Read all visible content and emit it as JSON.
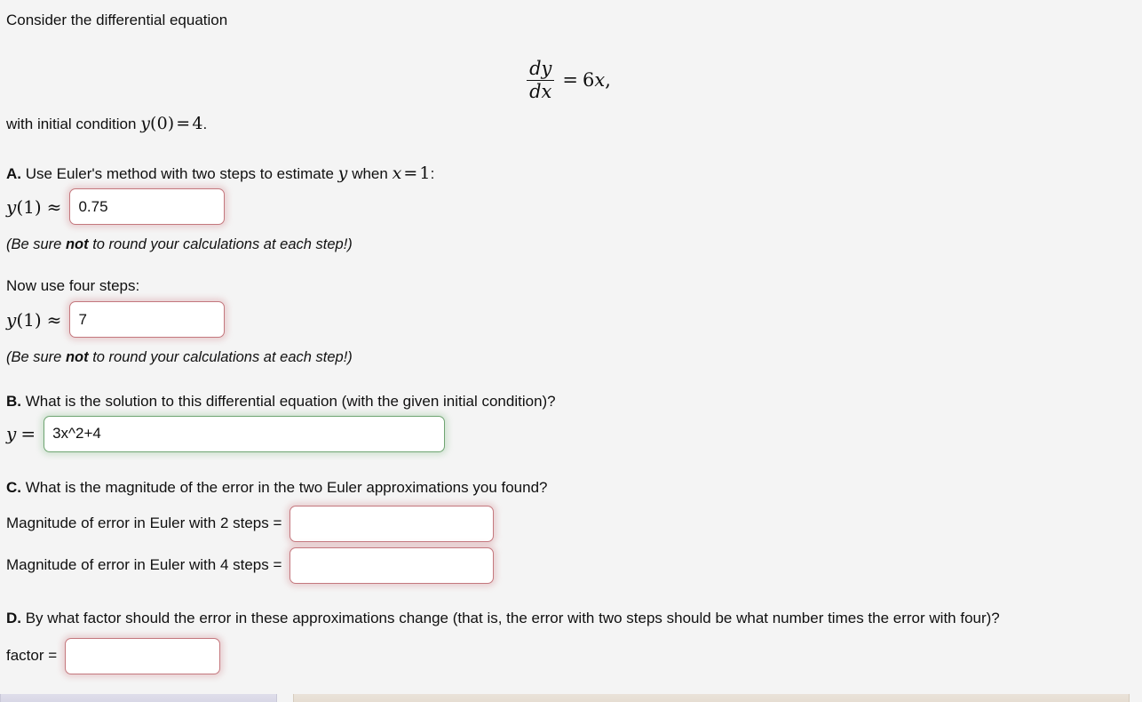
{
  "intro": {
    "text": "Consider the differential equation"
  },
  "equation": {
    "numerator": "dy",
    "denominator": "dx",
    "equals": "=",
    "rhs_coefficient": "6",
    "rhs_variable": "x",
    "trailing_comma": ","
  },
  "initial_condition": {
    "prefix": "with initial condition ",
    "function": "y",
    "open_paren": "(",
    "arg": "0",
    "close_paren": ")",
    "equals": "=",
    "value": "4",
    "period": "."
  },
  "part_a": {
    "letter": "A.",
    "prompt_1": " Use Euler's method with two steps to estimate ",
    "prompt_var": "y",
    "prompt_2": " when ",
    "prompt_x": "x",
    "prompt_equals": "=",
    "prompt_xval": "1",
    "prompt_colon": ":",
    "answer_label": {
      "function": "y",
      "open_paren": "(",
      "arg": "1",
      "close_paren": ")",
      "approx": "≈"
    },
    "answer_value_two_steps": "0.75",
    "answer_state_two_steps": "wrong",
    "hint_open": "(Be sure ",
    "hint_bold": "not",
    "hint_close": " to round your calculations at each step!)",
    "four_steps_prompt": "Now use four steps:",
    "answer_value_four_steps": "7",
    "answer_state_four_steps": "wrong"
  },
  "part_b": {
    "letter": "B.",
    "prompt": " What is the solution to this differential equation (with the given initial condition)?",
    "answer_label_var": "y",
    "answer_label_equals": "=",
    "answer_value": "3x^2+4",
    "answer_state": "right"
  },
  "part_c": {
    "letter": "C.",
    "prompt": " What is the magnitude of the error in the two Euler approximations you found?",
    "row_1_label": "Magnitude of error in Euler with 2 steps =",
    "row_1_value": "",
    "row_1_state": "wrong",
    "row_2_label": "Magnitude of error in Euler with 4 steps =",
    "row_2_value": "",
    "row_2_state": "wrong"
  },
  "part_d": {
    "letter": "D.",
    "prompt": " By what factor should the error in these approximations change (that is, the error with two steps should be what number times the error with four)?",
    "factor_label": "factor =",
    "factor_value": "",
    "factor_state": "wrong"
  },
  "colors": {
    "page_background": "#f4f4f4",
    "text": "#101010",
    "incorrect_border": "#c4787e",
    "correct_border": "#6fa572",
    "input_background": "#ffffff"
  }
}
